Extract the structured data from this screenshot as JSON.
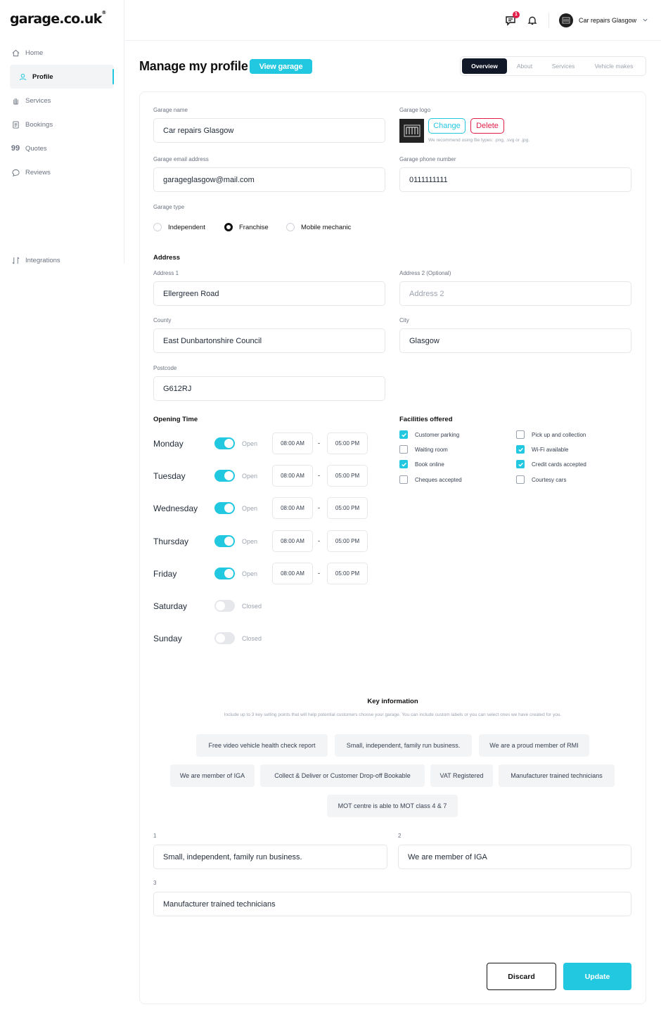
{
  "brand": {
    "logo": "garage.co.uk",
    "accent": "#22c7e0",
    "danger": "#e11d48"
  },
  "sidebar": {
    "items": [
      {
        "label": "Home",
        "icon": "home-icon"
      },
      {
        "label": "Profile",
        "icon": "user-icon",
        "active": true
      },
      {
        "label": "Services",
        "icon": "hand-icon"
      },
      {
        "label": "Bookings",
        "icon": "document-icon"
      },
      {
        "label": "Quotes",
        "icon": "quote-icon"
      },
      {
        "label": "Reviews",
        "icon": "chat-icon"
      },
      {
        "label": "Integrations",
        "icon": "integrations-icon"
      }
    ]
  },
  "topbar": {
    "notification_count": "1",
    "user_name": "Car repairs Glasgow"
  },
  "header": {
    "title": "Manage my profile",
    "view_garage": "View garage",
    "tabs": [
      "Overview",
      "About",
      "Services",
      "Vehicle makes"
    ],
    "active_tab": "Overview"
  },
  "form": {
    "garage_name": {
      "label": "Garage name",
      "value": "Car repairs Glasgow"
    },
    "garage_logo": {
      "label": "Garage logo",
      "change": "Change",
      "delete": "Delete",
      "hint": "We recommend using file types: .png, .svg or .jpg."
    },
    "email": {
      "label": "Garage email address",
      "value": "garageglasgow@mail.com"
    },
    "phone": {
      "label": "Garage phone number",
      "value": "0111111111"
    },
    "garage_type": {
      "label": "Garage type",
      "options": [
        "Independent",
        "Franchise",
        "Mobile mechanic"
      ],
      "selected": "Franchise"
    },
    "address": {
      "title": "Address",
      "address1": {
        "label": "Address 1",
        "value": "Ellergreen Road"
      },
      "address2": {
        "label": "Address 2 (Optional)",
        "placeholder": "Address 2"
      },
      "county": {
        "label": "County",
        "value": "East Dunbartonshire Council"
      },
      "city": {
        "label": "City",
        "value": "Glasgow"
      },
      "postcode": {
        "label": "Postcode",
        "value": "G612RJ"
      }
    }
  },
  "opening": {
    "title": "Opening Time",
    "days": [
      {
        "day": "Monday",
        "open": true,
        "state": "Open",
        "from": "08:00 AM",
        "to": "05:00 PM"
      },
      {
        "day": "Tuesday",
        "open": true,
        "state": "Open",
        "from": "08:00 AM",
        "to": "05:00 PM"
      },
      {
        "day": "Wednesday",
        "open": true,
        "state": "Open",
        "from": "08:00 AM",
        "to": "05:00 PM"
      },
      {
        "day": "Thursday",
        "open": true,
        "state": "Open",
        "from": "08:00 AM",
        "to": "05:00 PM"
      },
      {
        "day": "Friday",
        "open": true,
        "state": "Open",
        "from": "08:00 AM",
        "to": "05:00 PM"
      },
      {
        "day": "Saturday",
        "open": false,
        "state": "Closed"
      },
      {
        "day": "Sunday",
        "open": false,
        "state": "Closed"
      }
    ],
    "separator": "-"
  },
  "facilities": {
    "title": "Facilities offered",
    "items": [
      {
        "label": "Customer parking",
        "checked": true
      },
      {
        "label": "Pick up and collection",
        "checked": false
      },
      {
        "label": "Waiting room",
        "checked": false
      },
      {
        "label": "Wi-Fi available",
        "checked": true
      },
      {
        "label": "Book online",
        "checked": true
      },
      {
        "label": "Credit cards accepted",
        "checked": true
      },
      {
        "label": "Cheques accepted",
        "checked": false
      },
      {
        "label": "Courtesy cars",
        "checked": false
      }
    ]
  },
  "key_info": {
    "title": "Key information",
    "subtitle": "Include up to 3 key selling points that will help potential customers choose your garage. You can include custom labels or you can select ones we have created for you.",
    "chips": [
      "Free video vehicle health check report",
      "Small, independent, family run business.",
      "We are a proud member of RMI",
      "We are member of IGA",
      "Collect & Deliver or Customer Drop-off Bookable",
      "VAT Registered",
      "Manufacturer trained technicians",
      "MOT centre is able to MOT class 4 & 7"
    ],
    "selected": [
      {
        "num": "1",
        "value": "Small, independent, family run business."
      },
      {
        "num": "2",
        "value": "We are member of IGA"
      },
      {
        "num": "3",
        "value": "Manufacturer trained technicians"
      }
    ]
  },
  "actions": {
    "discard": "Discard",
    "update": "Update"
  }
}
